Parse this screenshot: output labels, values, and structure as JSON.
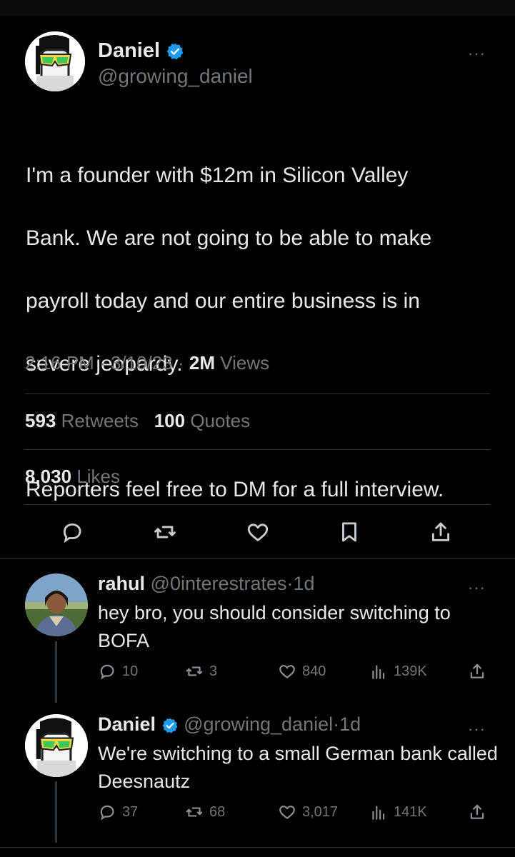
{
  "main_tweet": {
    "name": "Daniel",
    "handle": "@growing_daniel",
    "text_lines": [
      "I'm a founder with $12m in Silicon Valley",
      "Bank. We are not going to be able to make",
      "payroll today and our entire business is in",
      "severe jeopardy."
    ],
    "text_line_2": "Reporters feel free to DM for a full interview.",
    "time": "2:16 PM",
    "date": "3/10/23",
    "views_count": "2M",
    "views_label": "Views",
    "retweets_count": "593",
    "retweets_label": "Retweets",
    "quotes_count": "100",
    "quotes_label": "Quotes",
    "likes_count": "8,030",
    "likes_label": "Likes",
    "more_glyph": "···",
    "separator": "·",
    "icons": [
      "reply-icon",
      "retweet-icon",
      "like-icon",
      "bookmark-icon",
      "share-icon"
    ]
  },
  "replies": [
    {
      "name": "rahul",
      "handle": "@0interestrates",
      "age": "1d",
      "text": "hey bro, you should consider switching to BOFA",
      "reply_count": "10",
      "retweet_count": "3",
      "like_count": "840",
      "view_count": "139K"
    },
    {
      "name": "Daniel",
      "handle": "@growing_daniel",
      "age": "1d",
      "text": "We're switching to a small German bank called Deesnautz",
      "reply_count": "37",
      "retweet_count": "68",
      "like_count": "3,017",
      "view_count": "141K"
    }
  ],
  "colors": {
    "background": "#000000",
    "text": "#e7e9ea",
    "muted": "#71767b",
    "divider": "#2f3336",
    "verified": "#1d9bf0"
  }
}
